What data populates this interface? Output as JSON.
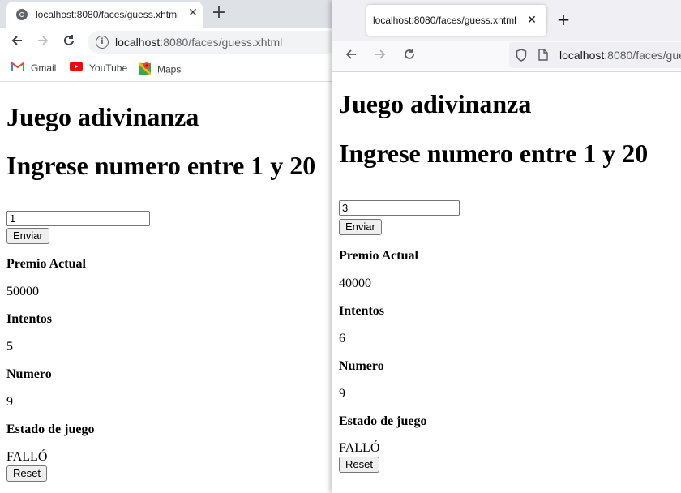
{
  "chrome": {
    "tab_title": "localhost:8080/faces/guess.xhtml",
    "url_host": "localhost",
    "url_rest": ":8080/faces/guess.xhtml",
    "bookmarks": [
      {
        "label": "Gmail",
        "icon": "gmail-icon"
      },
      {
        "label": "YouTube",
        "icon": "youtube-icon"
      },
      {
        "label": "Maps",
        "icon": "maps-icon"
      }
    ],
    "page": {
      "title": "Juego adivinanza",
      "subtitle": "Ingrese numero entre 1 y 20",
      "input_value": "1",
      "send_label": "Enviar",
      "prize_label": "Premio Actual",
      "prize_value": "50000",
      "attempts_label": "Intentos",
      "attempts_value": "5",
      "number_label": "Numero",
      "number_value": "9",
      "state_label": "Estado de juego",
      "state_value": "FALLÓ",
      "reset_label": "Reset"
    }
  },
  "firefox": {
    "tab_title": "localhost:8080/faces/guess.xhtml",
    "url_host": "localhost",
    "url_rest": ":8080/faces/gue",
    "page": {
      "title": "Juego adivinanza",
      "subtitle": "Ingrese numero entre 1 y 20",
      "input_value": "3",
      "send_label": "Enviar",
      "prize_label": "Premio Actual",
      "prize_value": "40000",
      "attempts_label": "Intentos",
      "attempts_value": "6",
      "number_label": "Numero",
      "number_value": "9",
      "state_label": "Estado de juego",
      "state_value": "FALLÓ",
      "reset_label": "Reset"
    }
  },
  "colors": {
    "chrome_tabstrip": "#dee1e6",
    "firefox_tabstrip": "#f0f0f4",
    "gmail_red": "#ea4335",
    "youtube_red": "#ff0000"
  }
}
